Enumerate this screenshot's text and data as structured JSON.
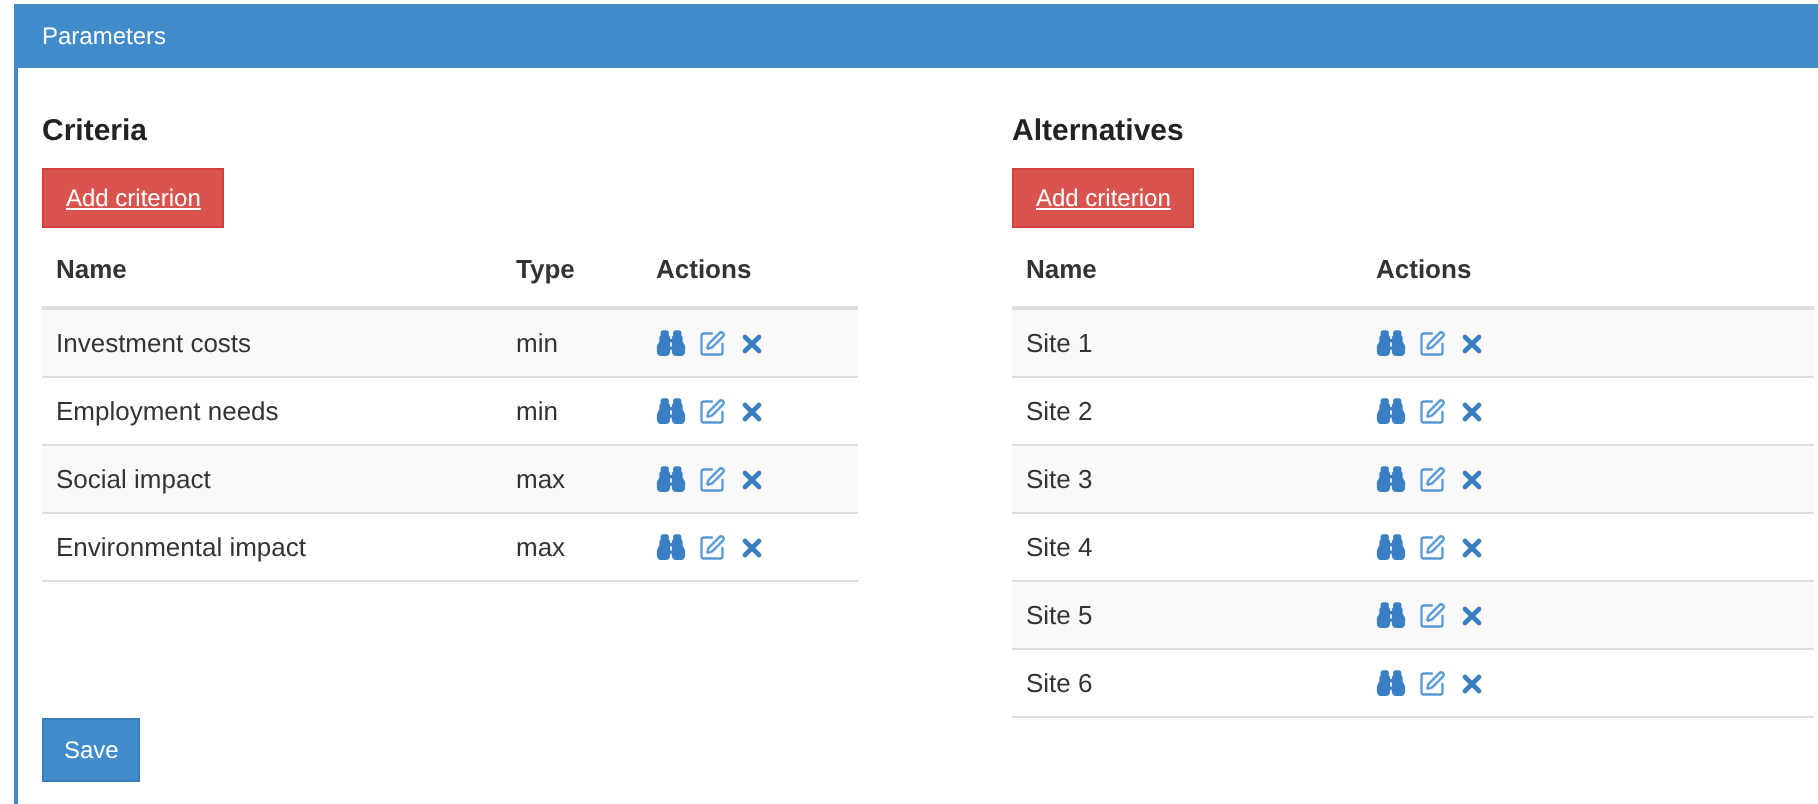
{
  "panel": {
    "title": "Parameters"
  },
  "criteria": {
    "title": "Criteria",
    "add_button": "Add criterion",
    "columns": [
      "Name",
      "Type",
      "Actions"
    ],
    "rows": [
      {
        "name": "Investment costs",
        "type": "min"
      },
      {
        "name": "Employment needs",
        "type": "min"
      },
      {
        "name": "Social impact",
        "type": "max"
      },
      {
        "name": "Environmental impact",
        "type": "max"
      }
    ]
  },
  "alternatives": {
    "title": "Alternatives",
    "add_button": "Add criterion",
    "columns": [
      "Name",
      "Actions"
    ],
    "rows": [
      {
        "name": "Site 1"
      },
      {
        "name": "Site 2"
      },
      {
        "name": "Site 3"
      },
      {
        "name": "Site 4"
      },
      {
        "name": "Site 5"
      },
      {
        "name": "Site 6"
      }
    ]
  },
  "save_button": "Save"
}
